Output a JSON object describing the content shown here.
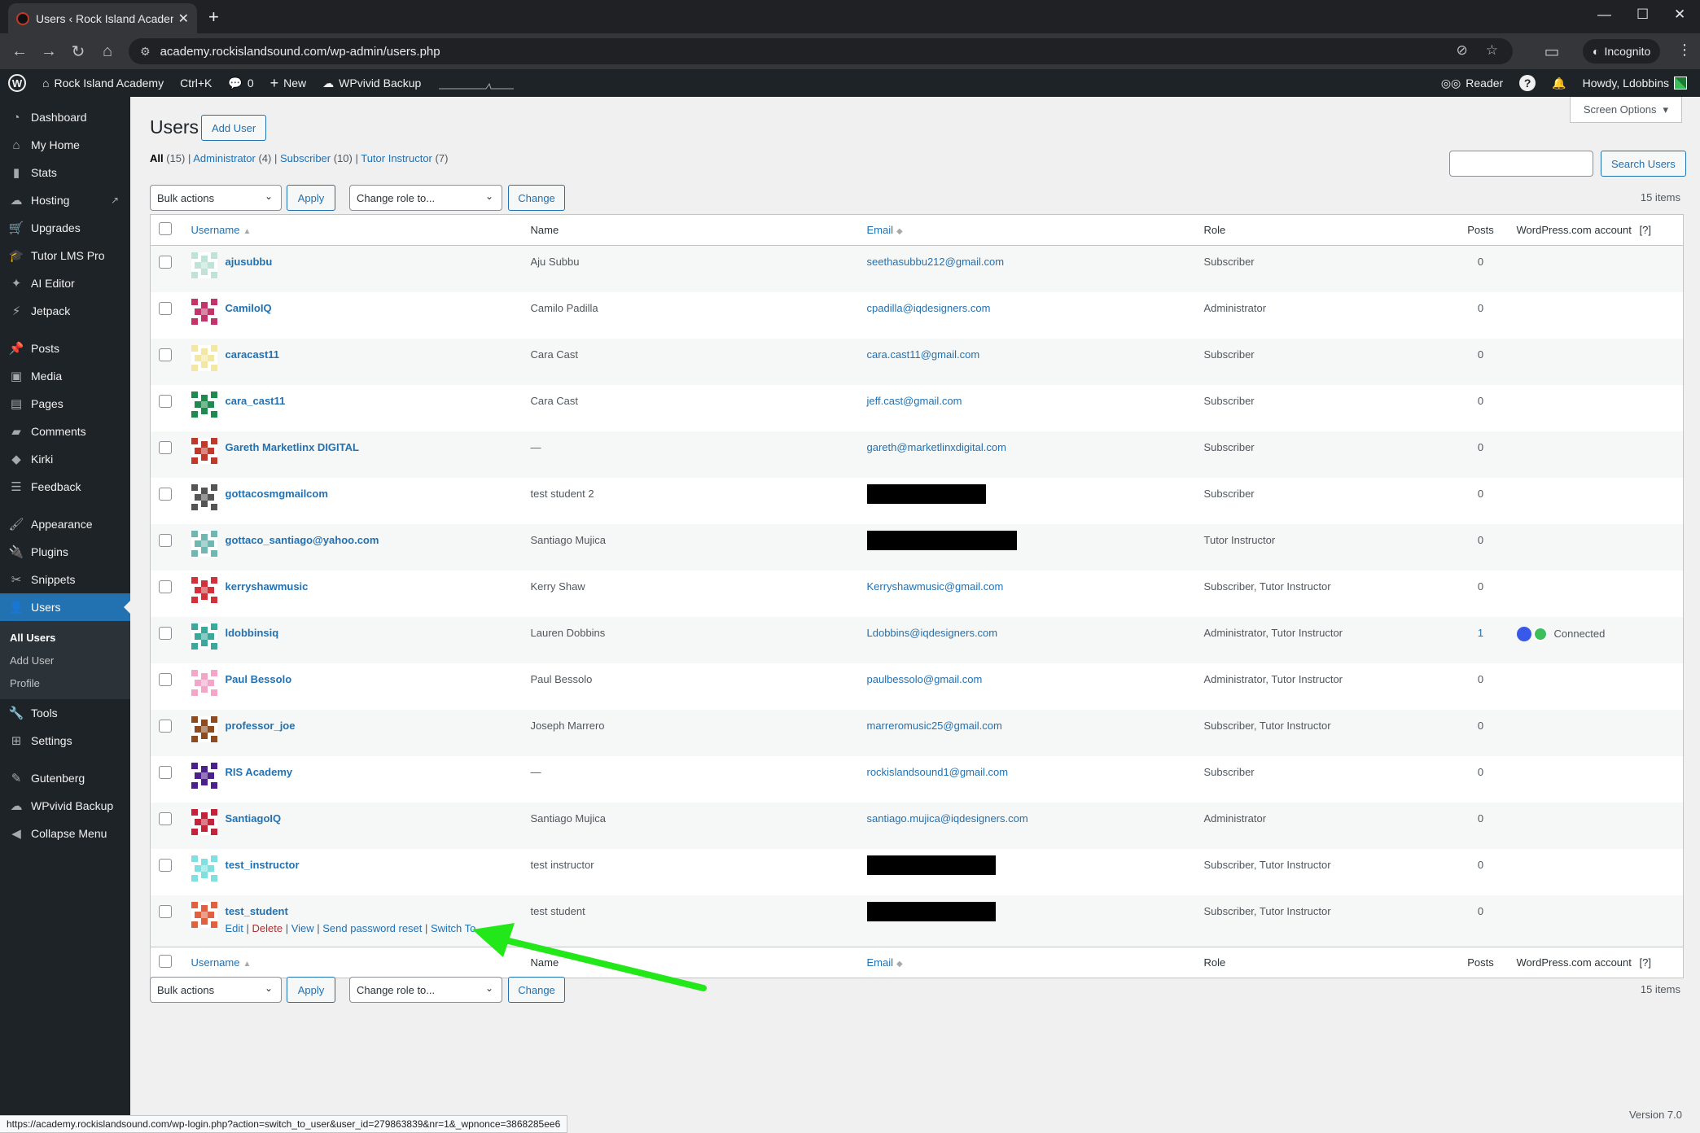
{
  "browser": {
    "tab_title": "Users ‹ Rock Island Academy —",
    "url": "academy.rockislandsound.com/wp-admin/users.php",
    "incognito_label": "Incognito",
    "status_url": "https://academy.rockislandsound.com/wp-login.php?action=switch_to_user&user_id=279863839&nr=1&_wpnonce=3868285ee6"
  },
  "adminbar": {
    "site_name": "Rock Island Academy",
    "shortcut": "Ctrl+K",
    "comments_count": "0",
    "new_label": "New",
    "wpvivid_label": "WPvivid Backup",
    "reader_label": "Reader",
    "howdy": "Howdy, Ldobbins"
  },
  "sidebar": {
    "items": [
      {
        "label": "Dashboard",
        "icon": "gauge-icon"
      },
      {
        "label": "My Home",
        "icon": "home-icon"
      },
      {
        "label": "Stats",
        "icon": "bar-chart-icon"
      },
      {
        "label": "Hosting",
        "icon": "cloud-icon"
      },
      {
        "label": "Upgrades",
        "icon": "cart-icon"
      },
      {
        "label": "Tutor LMS Pro",
        "icon": "graduation-icon"
      },
      {
        "label": "AI Editor",
        "icon": "sparkle-icon"
      },
      {
        "label": "Jetpack",
        "icon": "jetpack-icon"
      },
      {
        "label": "Posts",
        "icon": "pin-icon"
      },
      {
        "label": "Media",
        "icon": "media-icon"
      },
      {
        "label": "Pages",
        "icon": "pages-icon"
      },
      {
        "label": "Comments",
        "icon": "comment-icon"
      },
      {
        "label": "Kirki",
        "icon": "kirki-icon"
      },
      {
        "label": "Feedback",
        "icon": "feedback-icon"
      },
      {
        "label": "Appearance",
        "icon": "brush-icon"
      },
      {
        "label": "Plugins",
        "icon": "plug-icon"
      },
      {
        "label": "Snippets",
        "icon": "scissors-icon"
      },
      {
        "label": "Users",
        "icon": "user-icon"
      },
      {
        "label": "Tools",
        "icon": "wrench-icon"
      },
      {
        "label": "Settings",
        "icon": "settings-icon"
      },
      {
        "label": "Gutenberg",
        "icon": "pencil-icon"
      },
      {
        "label": "WPvivid Backup",
        "icon": "cloud-icon"
      },
      {
        "label": "Collapse Menu",
        "icon": "collapse-icon"
      }
    ],
    "submenu": [
      "All Users",
      "Add User",
      "Profile"
    ]
  },
  "page": {
    "screen_options": "Screen Options",
    "title": "Users",
    "add_user": "Add User",
    "filters": {
      "all": "All",
      "all_count": "(15)",
      "administrator": "Administrator",
      "administrator_count": "(4)",
      "subscriber": "Subscriber",
      "subscriber_count": "(10)",
      "tutor": "Tutor Instructor",
      "tutor_count": "(7)"
    },
    "search_button": "Search Users",
    "bulk_actions": "Bulk actions",
    "apply": "Apply",
    "change_role": "Change role to...",
    "change": "Change",
    "items_count": "15 items",
    "footer_version": "Version 7.0"
  },
  "table": {
    "columns": {
      "username": "Username",
      "name": "Name",
      "email": "Email",
      "role": "Role",
      "posts": "Posts",
      "wpcom": "WordPress.com account",
      "wpcom_help": "[?]"
    },
    "rows": [
      {
        "username": "ajusubbu",
        "name": "Aju Subbu",
        "email": "seethasubbu212@gmail.com",
        "role": "Subscriber",
        "posts": "0",
        "avatar_color": "#bfe3d6"
      },
      {
        "username": "CamiloIQ",
        "name": "Camilo Padilla",
        "email": "cpadilla@iqdesigners.com",
        "role": "Administrator",
        "posts": "0",
        "avatar_color": "#c2356b"
      },
      {
        "username": "caracast11",
        "name": "Cara Cast",
        "email": "cara.cast11@gmail.com",
        "role": "Subscriber",
        "posts": "0",
        "avatar_color": "#f3e7a4"
      },
      {
        "username": "cara_cast11",
        "name": "Cara Cast",
        "email": "jeff.cast@gmail.com",
        "role": "Subscriber",
        "posts": "0",
        "avatar_color": "#1e8a4f"
      },
      {
        "username": "Gareth Marketlinx DIGITAL",
        "name": "—",
        "email": "gareth@marketlinxdigital.com",
        "role": "Subscriber",
        "posts": "0",
        "avatar_color": "#c0392b"
      },
      {
        "username": "gottacosmgmailcom",
        "name": "test student 2",
        "email": "",
        "role": "Subscriber",
        "posts": "0",
        "avatar_color": "#555555",
        "redacted_width": 146
      },
      {
        "username": "gottaco_santiago@yahoo.com",
        "name": "Santiago Mujica",
        "email": "",
        "role": "Tutor Instructor",
        "posts": "0",
        "avatar_color": "#6fb7b0",
        "redacted_width": 184
      },
      {
        "username": "kerryshawmusic",
        "name": "Kerry Shaw",
        "email": "Kerryshawmusic@gmail.com",
        "role": "Subscriber, Tutor Instructor",
        "posts": "0",
        "avatar_color": "#d0313b"
      },
      {
        "username": "ldobbinsiq",
        "name": "Lauren Dobbins",
        "email": "Ldobbins@iqdesigners.com",
        "role": "Administrator, Tutor Instructor",
        "posts": "1",
        "connected": "Connected",
        "avatar_color": "#3aa89a"
      },
      {
        "username": "Paul Bessolo",
        "name": "Paul Bessolo",
        "email": "paulbessolo@gmail.com",
        "role": "Administrator, Tutor Instructor",
        "posts": "0",
        "avatar_color": "#f2a7c9"
      },
      {
        "username": "professor_joe",
        "name": "Joseph Marrero",
        "email": "marreromusic25@gmail.com",
        "role": "Subscriber, Tutor Instructor",
        "posts": "0",
        "avatar_color": "#8e4a22"
      },
      {
        "username": "RIS Academy",
        "name": "—",
        "email": "rockislandsound1@gmail.com",
        "role": "Subscriber",
        "posts": "0",
        "avatar_color": "#4b1f8c"
      },
      {
        "username": "SantiagoIQ",
        "name": "Santiago Mujica",
        "email": "santiago.mujica@iqdesigners.com",
        "role": "Administrator",
        "posts": "0",
        "avatar_color": "#c3243a"
      },
      {
        "username": "test_instructor",
        "name": "test instructor",
        "email": "",
        "role": "Subscriber, Tutor Instructor",
        "posts": "0",
        "avatar_color": "#7fe0e0",
        "redacted_width": 158
      },
      {
        "username": "test_student",
        "name": "test student",
        "email": "",
        "role": "Subscriber, Tutor Instructor",
        "posts": "0",
        "avatar_color": "#e06040",
        "redacted_width": 158,
        "actions": {
          "edit": "Edit",
          "delete": "Delete",
          "view": "View",
          "reset": "Send password reset",
          "switch": "Switch To"
        }
      }
    ]
  },
  "colors": {
    "accent": "#2271b1",
    "sidebar": "#1d2327",
    "arrow": "#22e81a",
    "delete": "#b32d2e"
  }
}
